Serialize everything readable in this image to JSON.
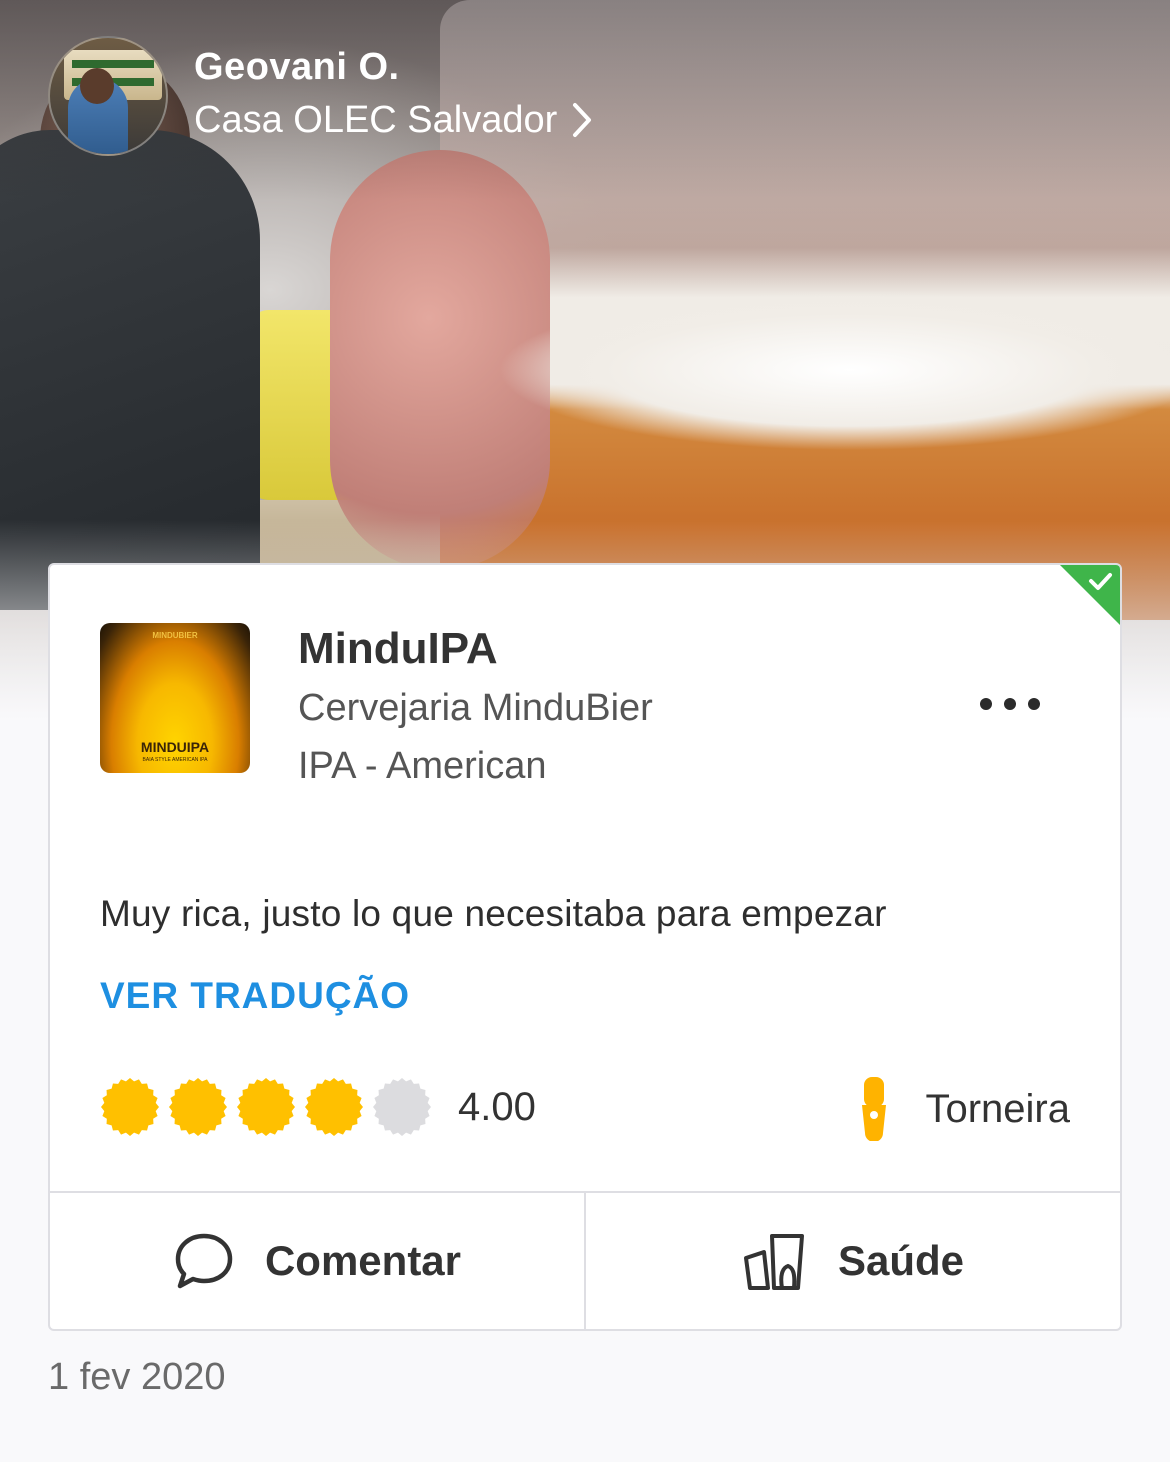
{
  "header": {
    "user_name": "Geovani O.",
    "venue": "Casa OLEC Salvador"
  },
  "checkin": {
    "beer_name": "MinduIPA",
    "brewery": "Cervejaria MinduBier",
    "style": "IPA - American",
    "label_art": {
      "brand_top": "MINDUBIER",
      "name": "MINDUIPA",
      "subtitle": "BAIA STYLE AMERICAN IPA"
    },
    "comment": "Muy rica, justo lo que necesitaba para empezar",
    "translate_label": "VER TRADUÇÃO",
    "rating": 4.0,
    "rating_max": 5,
    "rating_text": "4.00",
    "serving_style": "Torneira",
    "verified": true
  },
  "actions": {
    "comment_label": "Comentar",
    "toast_label": "Saúde"
  },
  "date": "1 fev 2020",
  "colors": {
    "accent_link": "#1e8fe1",
    "cap_filled": "#ffc000",
    "cap_empty": "#dcdcdf",
    "verified_badge": "#3fb54a",
    "serving_icon": "#ffb300"
  },
  "icons": [
    "chevron-right-icon",
    "verified-check-icon",
    "more-dots-icon",
    "bottle-cap-icon",
    "tap-handle-icon",
    "speech-bubble-icon",
    "cheers-glasses-icon"
  ]
}
